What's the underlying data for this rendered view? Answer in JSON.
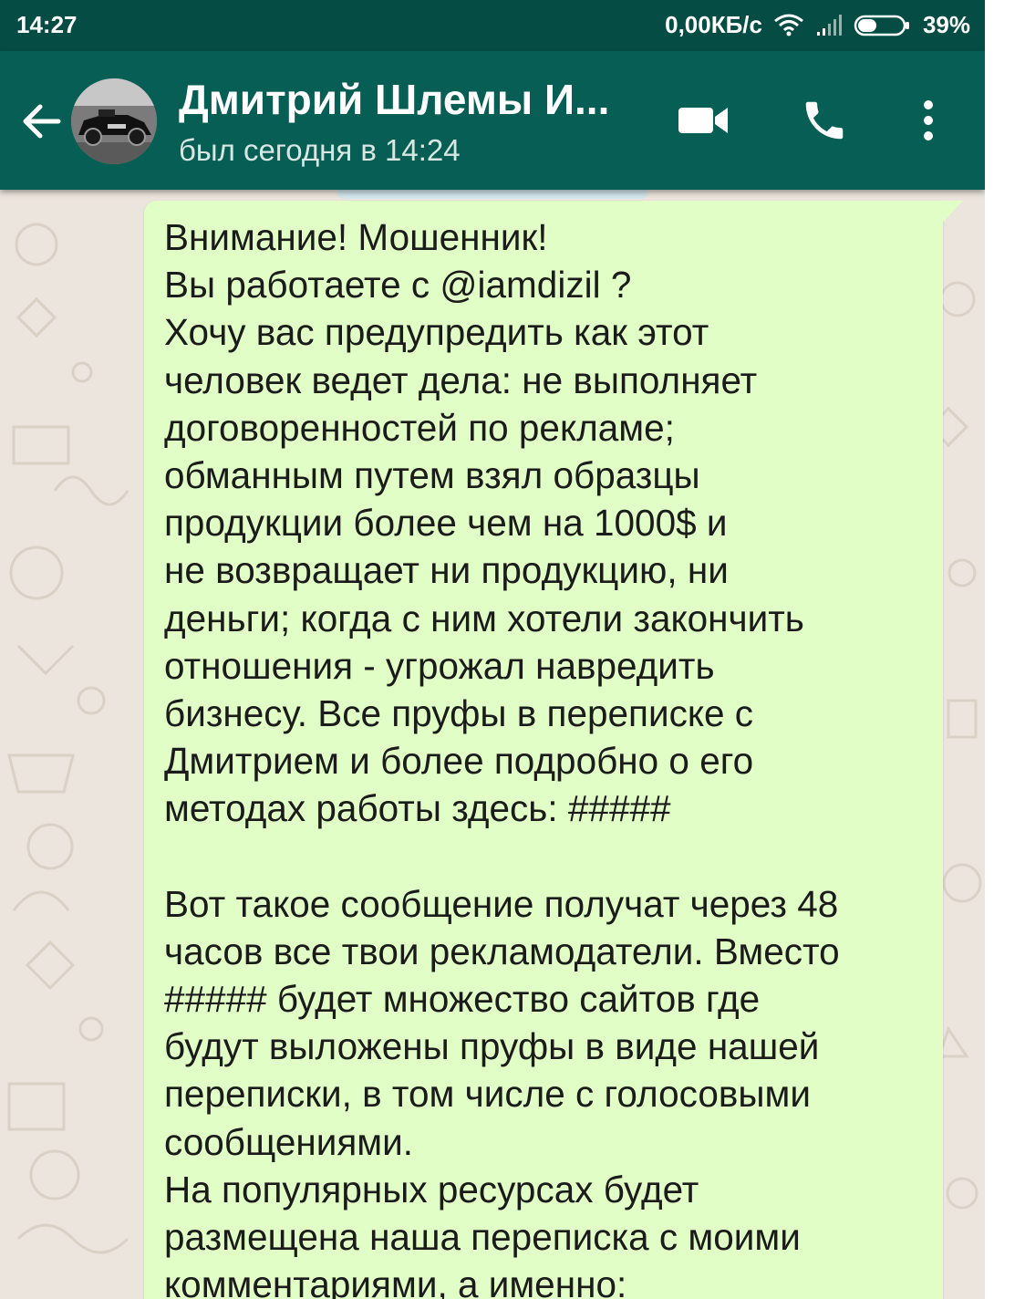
{
  "status_bar": {
    "time": "14:27",
    "network_speed": "0,00КБ/с",
    "battery": "39%",
    "icons": [
      "wifi-icon",
      "signal-icon",
      "battery-icon"
    ]
  },
  "header": {
    "contact_name": "Дмитрий Шлемы И...",
    "last_seen": "был сегодня в 14:24",
    "icons": [
      "back-arrow-icon",
      "video-call-icon",
      "phone-call-icon",
      "more-vert-icon"
    ]
  },
  "colors": {
    "status_bar": "#054d44",
    "app_bar": "#075e54",
    "chat_background": "#ece5dd",
    "outgoing_bubble": "#e1fec6"
  },
  "message": {
    "lines": [
      "Внимание! Мошенник!",
      "Вы работаете с @iamdizil ?",
      "Хочу вас предупредить как этот",
      "человек ведет дела: не выполняет",
      "договоренностей по рекламе;",
      "обманным путем взял образцы",
      "продукции более чем на 1000$ и",
      "не возвращает ни продукцию, ни",
      "деньги; когда с ним хотели закончить",
      "отношения - угрожал навредить",
      "бизнесу. Все пруфы в переписке с",
      "Дмитрием и более подробно о его",
      "методах работы здесь: #####",
      "",
      "Вот такое сообщение получат через 48",
      "часов все твои рекламодатели. Вместо",
      "##### будет множество сайтов где",
      "будут выложены пруфы в виде нашей",
      "переписки, в том числе с голосовыми",
      "сообщениями.",
      "На популярных ресурсах будет",
      "размещена наша переписка с моими",
      "комментариями, а именно:"
    ]
  }
}
